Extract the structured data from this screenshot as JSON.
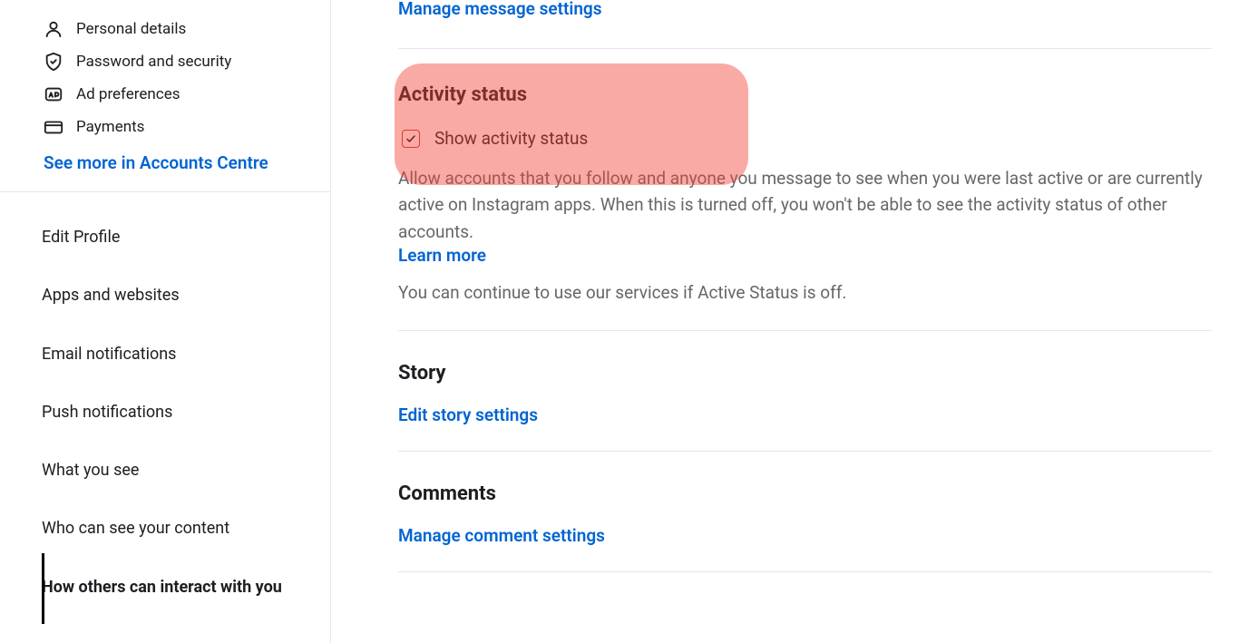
{
  "sidebar": {
    "top_items": [
      {
        "icon": "user-icon",
        "label": "Personal details"
      },
      {
        "icon": "shield-icon",
        "label": "Password and security"
      },
      {
        "icon": "ad-icon",
        "label": "Ad preferences"
      },
      {
        "icon": "card-icon",
        "label": "Payments"
      }
    ],
    "see_more": "See more in Accounts Centre",
    "nav": [
      {
        "label": "Edit Profile",
        "active": false
      },
      {
        "label": "Apps and websites",
        "active": false
      },
      {
        "label": "Email notifications",
        "active": false
      },
      {
        "label": "Push notifications",
        "active": false
      },
      {
        "label": "What you see",
        "active": false
      },
      {
        "label": "Who can see your content",
        "active": false
      },
      {
        "label": "How others can interact with you",
        "active": true
      }
    ]
  },
  "main": {
    "manage_messages": "Manage message settings",
    "activity": {
      "title": "Activity status",
      "checkbox_label": "Show activity status",
      "description": "Allow accounts that you follow and anyone you message to see when you were last active or are currently active on Instagram apps. When this is turned off, you won't be able to see the activity status of other accounts.",
      "learn_more": "Learn more",
      "footer": "You can continue to use our services if Active Status is off."
    },
    "story": {
      "title": "Story",
      "link": "Edit story settings"
    },
    "comments": {
      "title": "Comments",
      "link": "Manage comment settings"
    }
  }
}
